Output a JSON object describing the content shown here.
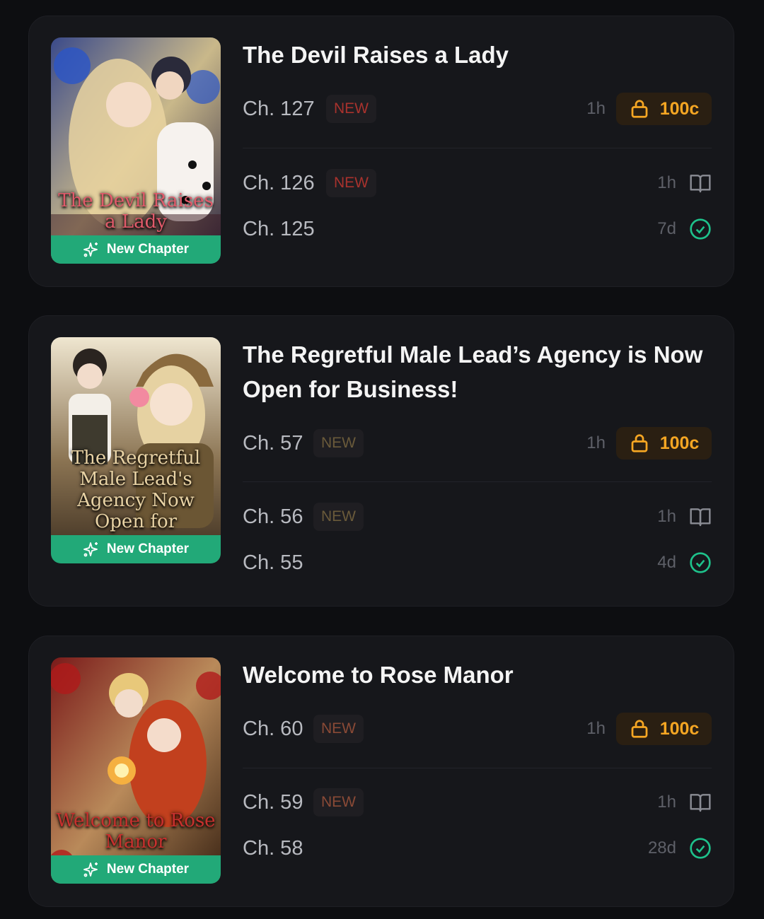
{
  "colors": {
    "background": "#0d0e11",
    "card": "#16171b",
    "badge_green": "#22a978",
    "coin_orange": "#f5a623",
    "read_check": "#1ec28b"
  },
  "badge_icon": "sparkles-icon",
  "series": [
    {
      "title": "The Devil Raises a Lady",
      "cover_title": "The Devil Raises a Lady",
      "badge": "New Chapter",
      "new_color": "#a8322d",
      "chapters": [
        {
          "label": "Ch. 127",
          "new": "NEW",
          "time": "1h",
          "price": "100c",
          "icon": "lock-icon"
        },
        {
          "label": "Ch. 126",
          "new": "NEW",
          "time": "1h",
          "icon": "book-open-icon"
        },
        {
          "label": "Ch. 125",
          "time": "7d",
          "icon": "check-circle-icon"
        }
      ]
    },
    {
      "title": "The Regretful Male Lead’s Agency is Now Open for Business!",
      "cover_title": "The Regretful Male Lead's Agency Now Open for",
      "badge": "New Chapter",
      "new_color": "#6a5a3a",
      "chapters": [
        {
          "label": "Ch. 57",
          "new": "NEW",
          "time": "1h",
          "price": "100c",
          "icon": "lock-icon"
        },
        {
          "label": "Ch. 56",
          "new": "NEW",
          "time": "1h",
          "icon": "book-open-icon"
        },
        {
          "label": "Ch. 55",
          "time": "4d",
          "icon": "check-circle-icon"
        }
      ]
    },
    {
      "title": "Welcome to Rose Manor",
      "cover_title": "Welcome to Rose Manor",
      "badge": "New Chapter",
      "new_color": "#8a4a36",
      "chapters": [
        {
          "label": "Ch. 60",
          "new": "NEW",
          "time": "1h",
          "price": "100c",
          "icon": "lock-icon"
        },
        {
          "label": "Ch. 59",
          "new": "NEW",
          "time": "1h",
          "icon": "book-open-icon"
        },
        {
          "label": "Ch. 58",
          "time": "28d",
          "icon": "check-circle-icon"
        }
      ]
    }
  ]
}
